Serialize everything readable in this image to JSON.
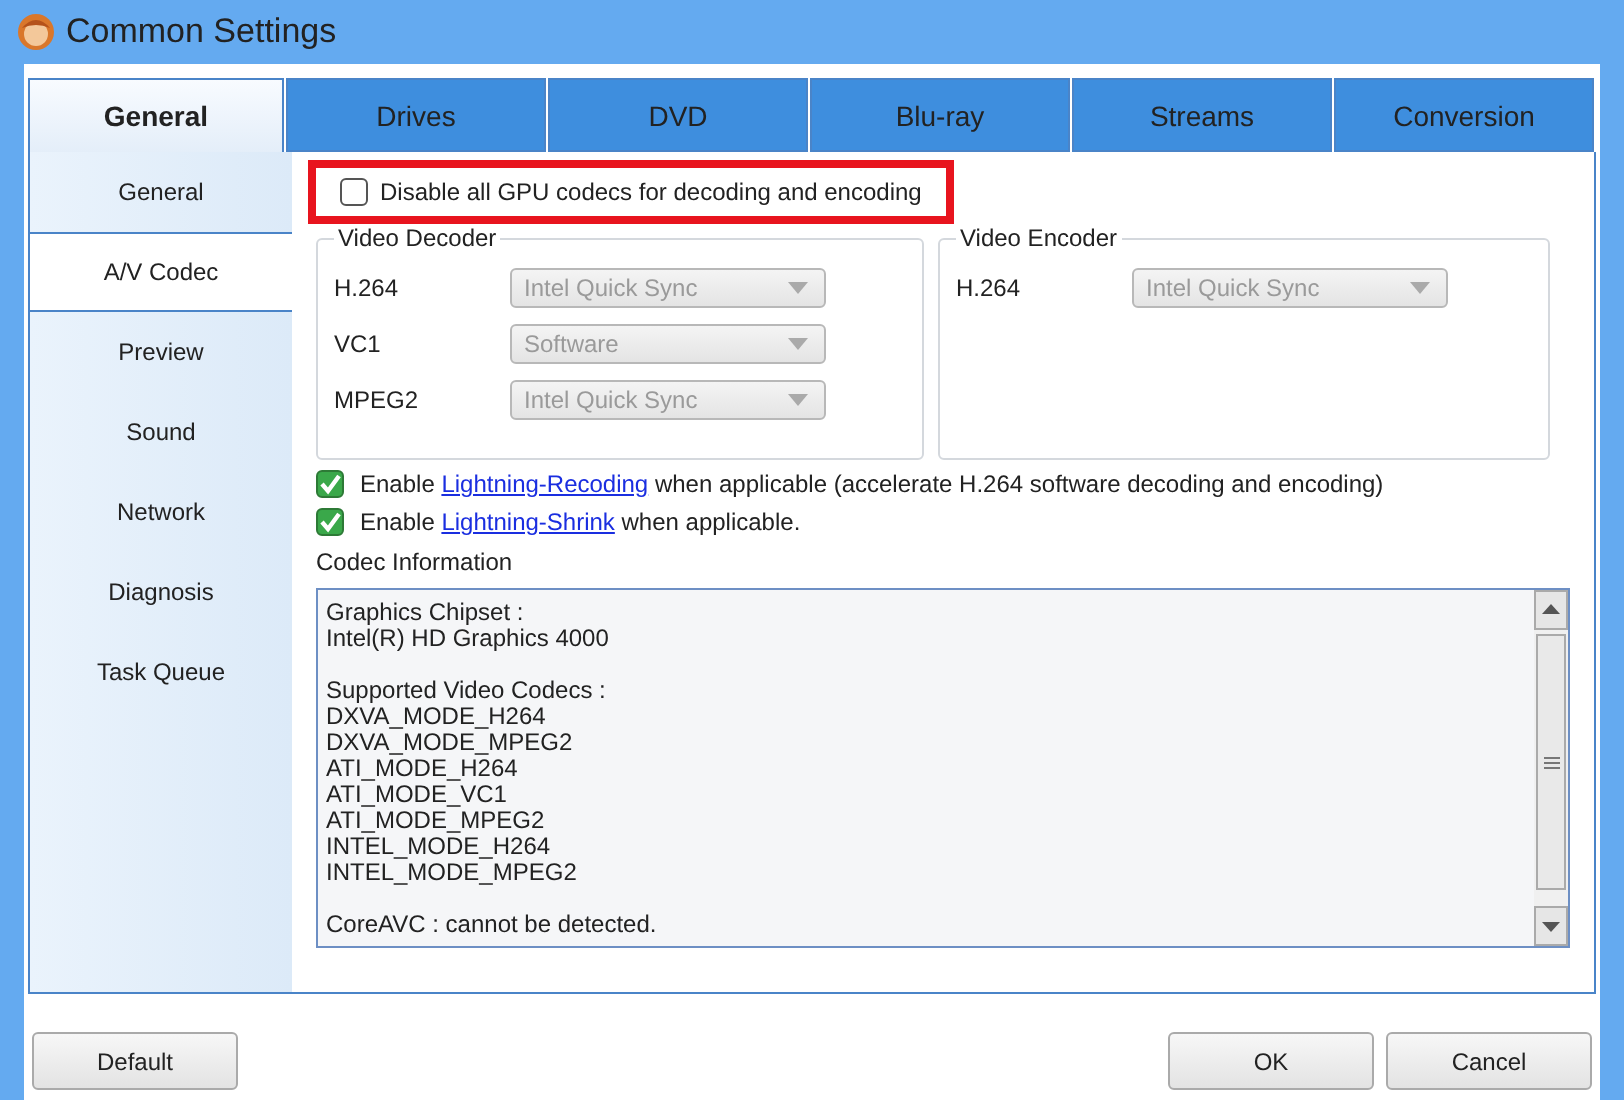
{
  "window": {
    "title": "Common Settings"
  },
  "tabs": [
    {
      "label": "General",
      "selected": true
    },
    {
      "label": "Drives",
      "selected": false
    },
    {
      "label": "DVD",
      "selected": false
    },
    {
      "label": "Blu-ray",
      "selected": false
    },
    {
      "label": "Streams",
      "selected": false
    },
    {
      "label": "Conversion",
      "selected": false
    }
  ],
  "sidebar": {
    "items": [
      {
        "label": "General",
        "selected": false
      },
      {
        "label": "A/V Codec",
        "selected": true
      },
      {
        "label": "Preview",
        "selected": false
      },
      {
        "label": "Sound",
        "selected": false
      },
      {
        "label": "Network",
        "selected": false
      },
      {
        "label": "Diagnosis",
        "selected": false
      },
      {
        "label": "Task Queue",
        "selected": false
      }
    ]
  },
  "gpu_option": {
    "label": "Disable all GPU codecs for decoding and encoding",
    "checked": false,
    "highlighted": true
  },
  "video_decoder": {
    "title": "Video Decoder",
    "rows": [
      {
        "label": "H.264",
        "value": "Intel Quick Sync",
        "disabled": true
      },
      {
        "label": "VC1",
        "value": "Software",
        "disabled": true
      },
      {
        "label": "MPEG2",
        "value": "Intel Quick Sync",
        "disabled": true
      }
    ]
  },
  "video_encoder": {
    "title": "Video Encoder",
    "rows": [
      {
        "label": "H.264",
        "value": "Intel Quick Sync",
        "disabled": true
      }
    ]
  },
  "options": [
    {
      "before": "Enable ",
      "link": "Lightning-Recoding",
      "after": " when applicable (accelerate H.264 software decoding and encoding)",
      "checked": true
    },
    {
      "before": "Enable ",
      "link": "Lightning-Shrink",
      "after": " when applicable.",
      "checked": true
    }
  ],
  "codec_information": {
    "title": "Codec Information",
    "paragraphs": [
      [
        "Graphics Chipset :",
        "Intel(R) HD Graphics 4000"
      ],
      [
        "Supported Video Codecs :",
        "DXVA_MODE_H264",
        "DXVA_MODE_MPEG2",
        "ATI_MODE_H264",
        "ATI_MODE_VC1",
        "ATI_MODE_MPEG2",
        "INTEL_MODE_H264",
        "INTEL_MODE_MPEG2"
      ],
      [
        "CoreAVC : cannot be detected."
      ]
    ]
  },
  "buttons": {
    "left": [
      "Default"
    ],
    "right": [
      "OK",
      "Cancel"
    ]
  }
}
